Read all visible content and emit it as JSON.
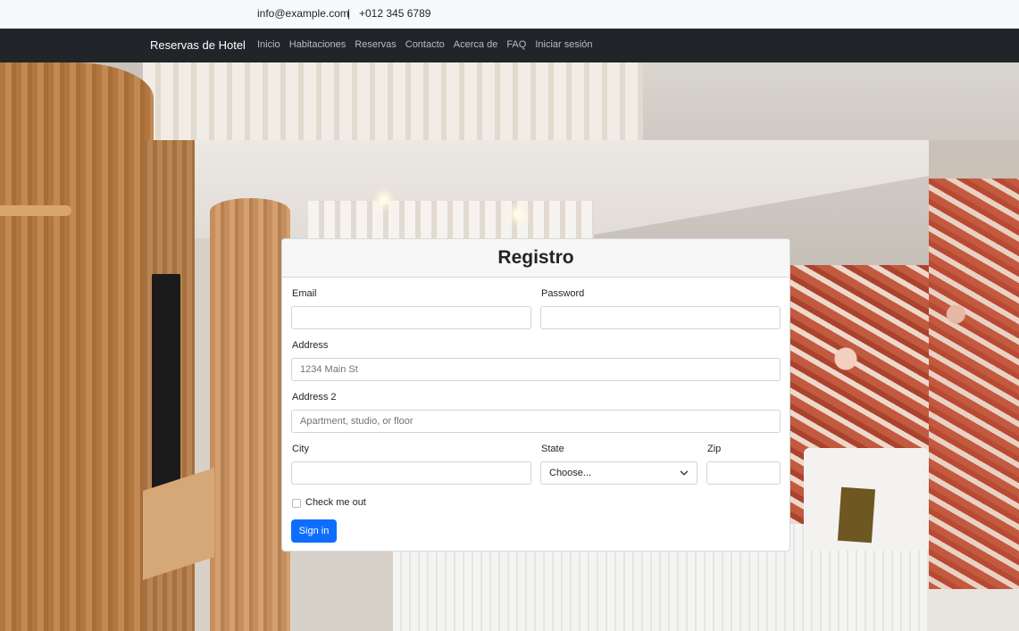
{
  "contact": {
    "email": "info@example.com",
    "separator": "|",
    "phone": "+012 345 6789"
  },
  "navbar": {
    "brand": "Reservas de Hotel",
    "links": [
      "Inicio",
      "Habitaciones",
      "Reservas",
      "Contacto",
      "Acerca de",
      "FAQ",
      "Iniciar sesión"
    ]
  },
  "form": {
    "title": "Registro",
    "email_label": "Email",
    "password_label": "Password",
    "address_label": "Address",
    "address_placeholder": "1234 Main St",
    "address2_label": "Address 2",
    "address2_placeholder": "Apartment, studio, or floor",
    "city_label": "City",
    "state_label": "State",
    "state_selected": "Choose...",
    "zip_label": "Zip",
    "checkbox_label": "Check me out",
    "checkbox_checked": false,
    "submit_label": "Sign in"
  },
  "colors": {
    "navbar_bg": "#212529",
    "primary": "#0d6efd",
    "topbar_bg": "#f8f9fa"
  },
  "icons": {
    "select_arrow": "chevron-down-icon"
  }
}
